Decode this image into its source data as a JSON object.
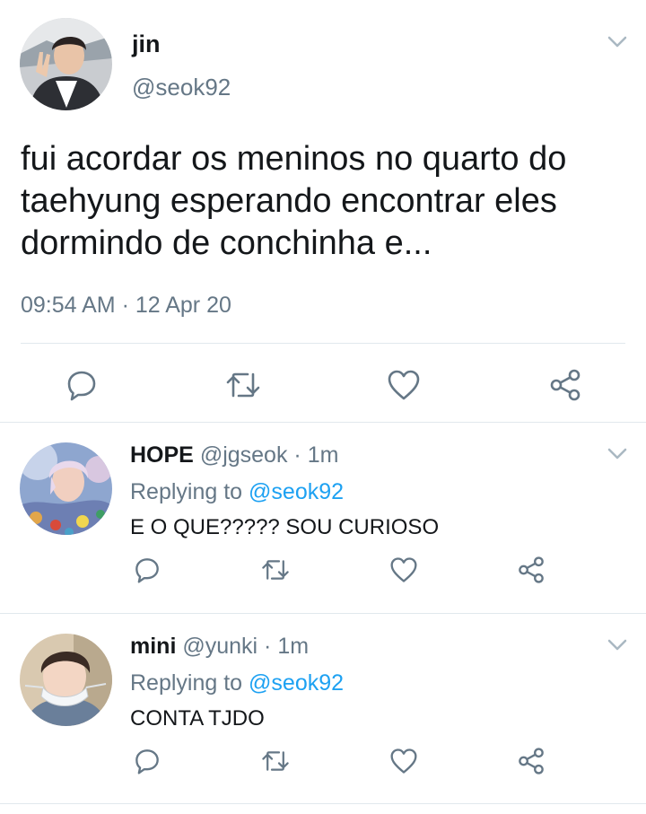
{
  "main_tweet": {
    "name": "jin",
    "handle": "@seok92",
    "text": "fui acordar os meninos no quarto do taehyung esperando encontrar eles dormindo de conchinha e...",
    "time": "09:54 AM",
    "date_sep": " · ",
    "date": "12 Apr 20",
    "icons": [
      "reply-icon",
      "retweet-icon",
      "like-icon",
      "share-icon",
      "chevron-down-icon"
    ]
  },
  "replies": [
    {
      "name": "HOPE",
      "handle": "@jgseok",
      "dot": " · ",
      "time": "1m",
      "replying_label": "Replying to ",
      "replying_to": "@seok92",
      "text": "E O QUE????? SOU CURIOSO"
    },
    {
      "name": "mini",
      "handle": "@yunki",
      "dot": " · ",
      "time": "1m",
      "replying_label": "Replying to ",
      "replying_to": "@seok92",
      "text": "CONTA TJDO"
    }
  ],
  "colors": {
    "text": "#14171a",
    "secondary": "#657786",
    "link": "#1da1f2",
    "divider": "#e1e8ed"
  }
}
